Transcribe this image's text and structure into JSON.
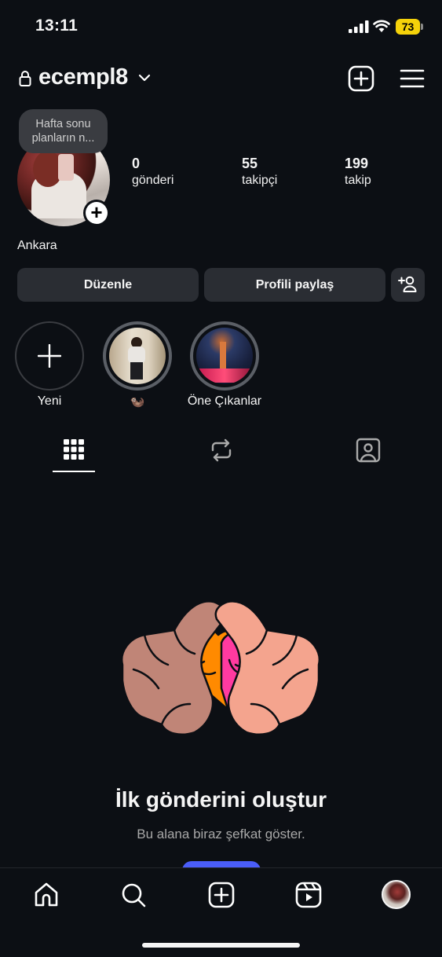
{
  "status_bar": {
    "time": "13:11",
    "battery": "73"
  },
  "header": {
    "username": "ecempl8"
  },
  "profile": {
    "note": "Hafta sonu planların n...",
    "stats": [
      {
        "value": "0",
        "label": "gönderi"
      },
      {
        "value": "55",
        "label": "takipçi"
      },
      {
        "value": "199",
        "label": "takip"
      }
    ],
    "location": "Ankara"
  },
  "buttons": {
    "edit": "Düzenle",
    "share": "Profili paylaş"
  },
  "highlights": [
    {
      "label": "Yeni"
    },
    {
      "label": "🦦"
    },
    {
      "label": "Öne Çıkanlar"
    }
  ],
  "empty_state": {
    "title": "İlk gönderini oluştur",
    "subtitle": "Bu alana biraz şefkat göster."
  },
  "colors": {
    "background": "#0c0f14",
    "button_bg": "#2a2d33",
    "battery": "#f5d20a",
    "cta": "#4a5df9"
  },
  "icons": [
    "lock-icon",
    "chevron-down-icon",
    "plus-square-icon",
    "menu-icon",
    "add-person-icon",
    "grid-icon",
    "repost-icon",
    "tagged-icon",
    "home-icon",
    "search-icon",
    "create-icon",
    "reels-icon"
  ]
}
